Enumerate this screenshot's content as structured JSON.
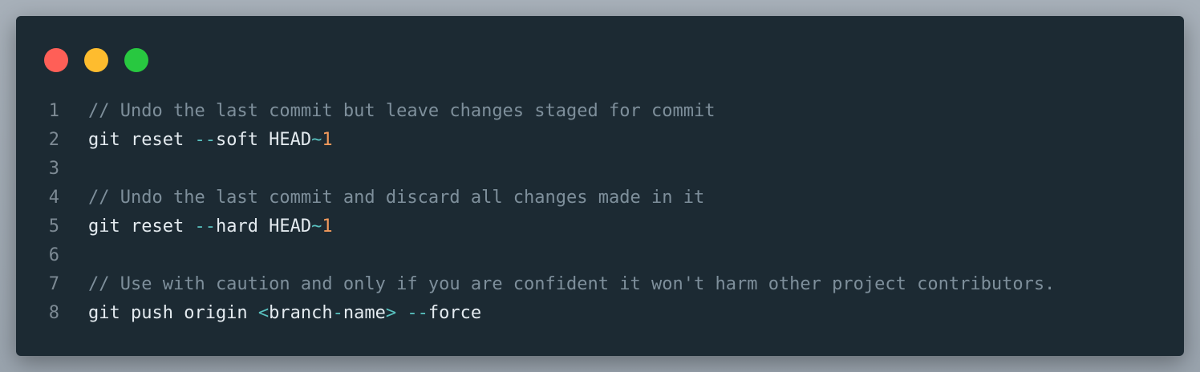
{
  "window": {
    "controls": [
      {
        "name": "close-button",
        "color": "#ff5f57"
      },
      {
        "name": "minimize-button",
        "color": "#febc2e"
      },
      {
        "name": "zoom-button",
        "color": "#28c840"
      }
    ]
  },
  "code": {
    "lines": [
      {
        "number": "1",
        "tokens": [
          {
            "type": "comment",
            "text": "// Undo the last commit but leave changes staged for commit"
          }
        ]
      },
      {
        "number": "2",
        "tokens": [
          {
            "type": "plain",
            "text": "git reset "
          },
          {
            "type": "operator",
            "text": "--"
          },
          {
            "type": "plain",
            "text": "soft HEAD"
          },
          {
            "type": "operator",
            "text": "~"
          },
          {
            "type": "number",
            "text": "1"
          }
        ]
      },
      {
        "number": "3",
        "tokens": []
      },
      {
        "number": "4",
        "tokens": [
          {
            "type": "comment",
            "text": "// Undo the last commit and discard all changes made in it"
          }
        ]
      },
      {
        "number": "5",
        "tokens": [
          {
            "type": "plain",
            "text": "git reset "
          },
          {
            "type": "operator",
            "text": "--"
          },
          {
            "type": "plain",
            "text": "hard HEAD"
          },
          {
            "type": "operator",
            "text": "~"
          },
          {
            "type": "number",
            "text": "1"
          }
        ]
      },
      {
        "number": "6",
        "tokens": []
      },
      {
        "number": "7",
        "tokens": [
          {
            "type": "comment",
            "text": "// Use with caution and only if you are confident it won't harm other project contributors."
          }
        ]
      },
      {
        "number": "8",
        "tokens": [
          {
            "type": "plain",
            "text": "git push origin "
          },
          {
            "type": "angle",
            "text": "<"
          },
          {
            "type": "plain",
            "text": "branch"
          },
          {
            "type": "operator",
            "text": "-"
          },
          {
            "type": "plain",
            "text": "name"
          },
          {
            "type": "angle",
            "text": ">"
          },
          {
            "type": "plain",
            "text": " "
          },
          {
            "type": "operator",
            "text": "--"
          },
          {
            "type": "plain",
            "text": "force"
          }
        ]
      }
    ]
  }
}
